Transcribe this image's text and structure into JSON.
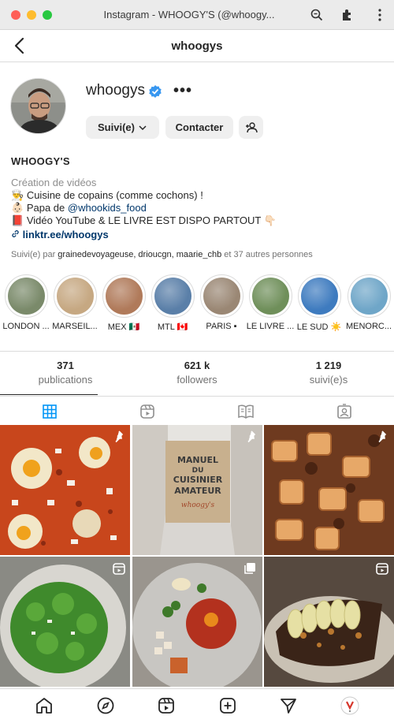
{
  "window": {
    "title": "Instagram - WHOOGY'S (@whoogy..."
  },
  "header": {
    "username": "whoogys"
  },
  "profile": {
    "username": "whoogys",
    "follow_label": "Suivi(e)",
    "contact_label": "Contacter",
    "bio_name": "WHOOGY'S",
    "category": "Création de vidéos",
    "bio_lines": [
      "Cuisine de copains (comme cochons) !",
      "Papa de",
      "Vidéo YouTube & LE LIVRE EST DISPO PARTOUT"
    ],
    "mention": "@whookids_food",
    "link": "linktr.ee/whoogys",
    "followed_by_prefix": "Suivi(e) par ",
    "followed_by_names": "grainedevoyageuse, drioucgn, maarie_chb",
    "followed_by_suffix": " et 37 autres personnes"
  },
  "highlights": [
    {
      "label": "LONDON ...",
      "color": "#7a8a6a"
    },
    {
      "label": "MARSEIL...",
      "color": "#c6a882"
    },
    {
      "label": "MEX 🇲🇽",
      "color": "#b07a5a"
    },
    {
      "label": "MTL 🇨🇦",
      "color": "#5a7fa8"
    },
    {
      "label": "PARIS ▪",
      "color": "#9a8774"
    },
    {
      "label": "LE LIVRE ...",
      "color": "#6f8f5a"
    },
    {
      "label": "LE SUD ☀️",
      "color": "#3e7bbf"
    },
    {
      "label": "MENORC...",
      "color": "#6fa6c8"
    }
  ],
  "stats": {
    "posts": {
      "value": "371",
      "label": "publications"
    },
    "followers": {
      "value": "621 k",
      "label": "followers"
    },
    "following": {
      "value": "1 219",
      "label": "suivi(e)s"
    }
  },
  "tabs": [
    "grid-icon",
    "reels-icon",
    "guide-icon",
    "tagged-icon"
  ],
  "colors": {
    "accent": "#0095f6",
    "link": "#00376b",
    "verified": "#3897f0"
  },
  "grid": [
    {
      "name": "post-shakshuka",
      "badge": "pin-icon"
    },
    {
      "name": "post-manuel-cuisinier-amateur",
      "badge": "pin-icon"
    },
    {
      "name": "post-rigatoni-ragu",
      "badge": "pin-icon"
    },
    {
      "name": "post-green-gnocchi",
      "badge": "reel-icon"
    },
    {
      "name": "post-tartare-plate",
      "badge": "carousel-icon"
    },
    {
      "name": "post-pear-toast",
      "badge": "reel-icon"
    }
  ],
  "book_cover": {
    "line1": "MANUEL",
    "line2": "DU",
    "line3": "CUISINIER",
    "line4": "AMATEUR",
    "brand": "whoogy's"
  }
}
